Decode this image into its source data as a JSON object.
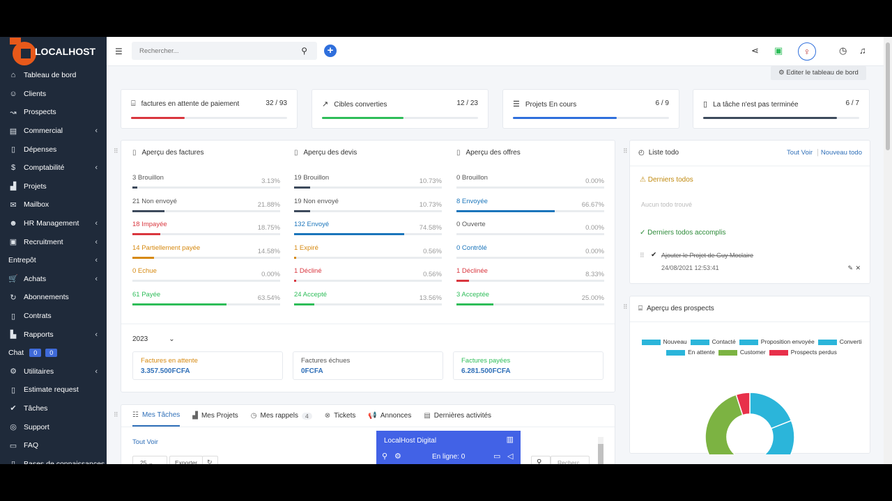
{
  "brand": {
    "name": "LOCALHOST"
  },
  "sidebar": {
    "items": [
      {
        "label": "Tableau de bord",
        "icon": "home-icon",
        "glyph": "⌂",
        "chevron": false
      },
      {
        "label": "Clients",
        "icon": "user-icon",
        "glyph": "☺",
        "chevron": false
      },
      {
        "label": "Prospects",
        "icon": "prospects-icon",
        "glyph": "↝",
        "chevron": false
      },
      {
        "label": "Commercial",
        "icon": "commercial-icon",
        "glyph": "▤",
        "chevron": true
      },
      {
        "label": "Dépenses",
        "icon": "expenses-icon",
        "glyph": "▯",
        "chevron": false
      },
      {
        "label": "Comptabilité",
        "icon": "dollar-icon",
        "glyph": "$",
        "chevron": true
      },
      {
        "label": "Projets",
        "icon": "chart-icon",
        "glyph": "▟",
        "chevron": false
      },
      {
        "label": "Mailbox",
        "icon": "mail-icon",
        "glyph": "✉",
        "chevron": false
      },
      {
        "label": "HR Management",
        "icon": "hr-icon",
        "glyph": "☻",
        "chevron": true
      },
      {
        "label": "Recruitment",
        "icon": "recruitment-icon",
        "glyph": "▣",
        "chevron": true
      },
      {
        "label": "Entrepôt",
        "icon": "",
        "glyph": "",
        "chevron": true
      },
      {
        "label": "Achats",
        "icon": "cart-icon",
        "glyph": "🛒",
        "chevron": true
      },
      {
        "label": "Abonnements",
        "icon": "refresh-icon",
        "glyph": "↻",
        "chevron": false
      },
      {
        "label": "Contrats",
        "icon": "contract-icon",
        "glyph": "▯",
        "chevron": false
      },
      {
        "label": "Rapports",
        "icon": "reports-icon",
        "glyph": "▙",
        "chevron": true
      },
      {
        "label": "Chat",
        "icon": "",
        "glyph": "",
        "chevron": false,
        "badges": [
          "0",
          "0"
        ]
      },
      {
        "label": "Utilitaires",
        "icon": "cogs-icon",
        "glyph": "⚙",
        "chevron": true
      },
      {
        "label": "Estimate request",
        "icon": "document-icon",
        "glyph": "▯",
        "chevron": false
      },
      {
        "label": "Tâches",
        "icon": "check-circle-icon",
        "glyph": "✔",
        "chevron": false
      },
      {
        "label": "Support",
        "icon": "support-icon",
        "glyph": "◎",
        "chevron": false
      },
      {
        "label": "FAQ",
        "icon": "folder-icon",
        "glyph": "▭",
        "chevron": false
      },
      {
        "label": "Bases de connaissances",
        "icon": "book-icon",
        "glyph": "▯",
        "chevron": false
      }
    ]
  },
  "topbar": {
    "search_placeholder": "Rechercher..."
  },
  "edit_dashboard_label": "Editer le tableau de bord",
  "stats": [
    {
      "label": "factures en attente de paiement",
      "count": "32 / 93",
      "progress": 0.344,
      "color": "#d9363e",
      "icon": "money-icon",
      "glyph": "⌸"
    },
    {
      "label": "Cibles converties",
      "count": "12 / 23",
      "progress": 0.522,
      "color": "#2ebd59",
      "icon": "trend-up-icon",
      "glyph": "↗"
    },
    {
      "label": "Projets En cours",
      "count": "6 / 9",
      "progress": 0.667,
      "color": "#2f6fdc",
      "icon": "sliders-icon",
      "glyph": "☰"
    },
    {
      "label": "La tâche n'est pas terminée",
      "count": "6 / 7",
      "progress": 0.857,
      "color": "#3d4a5c",
      "icon": "file-check-icon",
      "glyph": "▯"
    }
  ],
  "overview": {
    "columns": [
      {
        "title": "Aperçu des factures",
        "rows": [
          {
            "label": "3 Brouillon",
            "pct": "3.13%",
            "value": 3.13,
            "color": "#3d4a5c"
          },
          {
            "label": "21 Non envoyé",
            "pct": "21.88%",
            "value": 21.88,
            "color": "#3d4a5c"
          },
          {
            "label": "18 Impayée",
            "pct": "18.75%",
            "value": 18.75,
            "color": "#d9363e"
          },
          {
            "label": "14 Partiellement payée",
            "pct": "14.58%",
            "value": 14.58,
            "color": "#d68910"
          },
          {
            "label": "0 Echue",
            "pct": "0.00%",
            "value": 0,
            "color": "#d68910"
          },
          {
            "label": "61 Payée",
            "pct": "63.54%",
            "value": 63.54,
            "color": "#2ebd59"
          }
        ]
      },
      {
        "title": "Aperçu des devis",
        "rows": [
          {
            "label": "19 Brouillon",
            "pct": "10.73%",
            "value": 10.73,
            "color": "#3d4a5c"
          },
          {
            "label": "19 Non envoyé",
            "pct": "10.73%",
            "value": 10.73,
            "color": "#3d4a5c"
          },
          {
            "label": "132 Envoyé",
            "pct": "74.58%",
            "value": 74.58,
            "color": "#1b75bb"
          },
          {
            "label": "1 Expiré",
            "pct": "0.56%",
            "value": 0.56,
            "color": "#d68910"
          },
          {
            "label": "1 Décliné",
            "pct": "0.56%",
            "value": 0.56,
            "color": "#d9363e"
          },
          {
            "label": "24 Accepté",
            "pct": "13.56%",
            "value": 13.56,
            "color": "#2ebd59"
          }
        ]
      },
      {
        "title": "Aperçu des offres",
        "rows": [
          {
            "label": "0 Brouillon",
            "pct": "0.00%",
            "value": 0,
            "color": "#3d4a5c"
          },
          {
            "label": "8 Envoyée",
            "pct": "66.67%",
            "value": 66.67,
            "color": "#1b75bb"
          },
          {
            "label": "0 Ouverte",
            "pct": "0.00%",
            "value": 0,
            "color": "#3d4a5c"
          },
          {
            "label": "0 Contrôlé",
            "pct": "0.00%",
            "value": 0,
            "color": "#1b75bb"
          },
          {
            "label": "1 Déclinée",
            "pct": "8.33%",
            "value": 8.33,
            "color": "#d9363e"
          },
          {
            "label": "3 Acceptée",
            "pct": "25.00%",
            "value": 25,
            "color": "#2ebd59"
          }
        ]
      }
    ],
    "year": "2023",
    "summary": [
      {
        "label": "Factures en attente",
        "value": "3.357.500FCFA",
        "color": "#d68910"
      },
      {
        "label": "Factures échues",
        "value": "0FCFA",
        "color": "#555555"
      },
      {
        "label": "Factures payées",
        "value": "6.281.500FCFA",
        "color": "#2ebd59"
      }
    ]
  },
  "tabs": {
    "items": [
      "Mes Tâches",
      "Mes Projets",
      "Mes rappels",
      "Tickets",
      "Annonces",
      "Dernières activités"
    ],
    "reminders_count": "4",
    "view_all": "Tout Voir",
    "page_size": "25",
    "export": "Exporter",
    "search_placeholder": "Recherc"
  },
  "todo": {
    "title": "Liste todo",
    "view_all": "Tout Voir",
    "new": "Nouveau todo",
    "latest": "Derniers todos",
    "empty": "Aucun todo trouvé",
    "completed": "Derniers todos accomplis",
    "item": "Ajouter le Projet de Guy Moclaire",
    "item_date": "24/08/2021 12:53:41"
  },
  "chat_widget": {
    "title": "LocalHost Digital",
    "online": "En ligne: 0"
  },
  "chart_data": {
    "type": "pie",
    "title": "Aperçu des prospects",
    "legend": [
      {
        "name": "Nouveau",
        "color": "#2bb5da"
      },
      {
        "name": "Contacté",
        "color": "#2bb5da"
      },
      {
        "name": "Proposition envoyée",
        "color": "#2bb5da"
      },
      {
        "name": "Converti",
        "color": "#2bb5da"
      },
      {
        "name": "En attente",
        "color": "#2bb5da"
      },
      {
        "name": "Customer",
        "color": "#7cb342"
      },
      {
        "name": "Prospects perdus",
        "color": "#e8304a"
      }
    ],
    "slices": [
      {
        "name": "Converti",
        "value": 19,
        "color": "#2bb5da"
      },
      {
        "name": "En attente",
        "value": 26,
        "color": "#2bb5da"
      },
      {
        "name": "Customer",
        "value": 50,
        "color": "#7cb342"
      },
      {
        "name": "Prospects perdus",
        "value": 5,
        "color": "#e8304a"
      }
    ]
  }
}
